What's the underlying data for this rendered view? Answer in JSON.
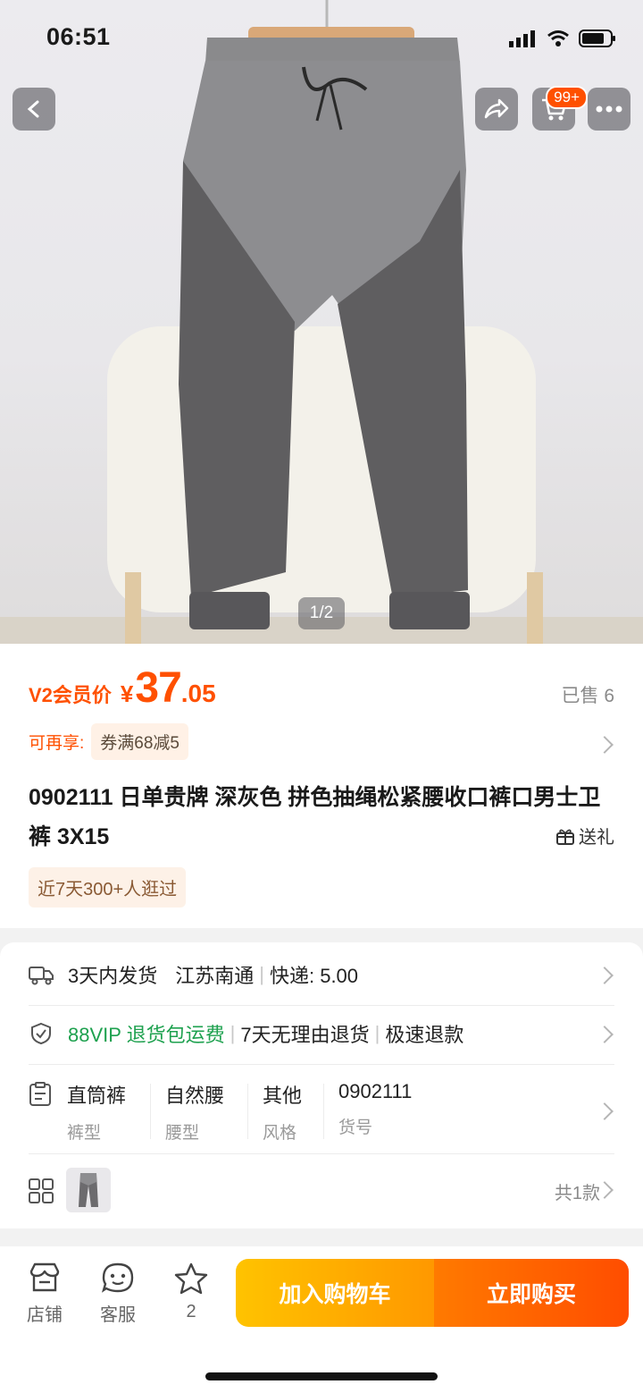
{
  "status_bar": {
    "time": "06:51"
  },
  "hero": {
    "pager": "1/2",
    "cart_badge": "99+",
    "image_alt": "grey jogger pants"
  },
  "price": {
    "label": "V2会员价",
    "currency": "¥",
    "integer": "37",
    "decimal": ".05",
    "sold": "已售 6"
  },
  "promo": {
    "label": "可再享:",
    "coupon": "券满68减5"
  },
  "product": {
    "title": "0902111 日单贵牌 深灰色 拼色抽绳松紧腰收口裤口男士卫裤 3X15",
    "gift": "送礼",
    "browse": "近7天300+人逛过"
  },
  "shipping": {
    "time": "3天内发货",
    "origin": "江苏南通",
    "fee": "快递: 5.00"
  },
  "service": {
    "vip": "88VIP 退货包运费",
    "return": "7天无理由退货",
    "refund": "极速退款"
  },
  "attributes": [
    {
      "value": "直筒裤",
      "key": "裤型"
    },
    {
      "value": "自然腰",
      "key": "腰型"
    },
    {
      "value": "其他",
      "key": "风格"
    },
    {
      "value": "0902111",
      "key": "货号"
    }
  ],
  "variants": {
    "count": "共1款"
  },
  "bottom_bar": {
    "shop": "店铺",
    "service": "客服",
    "fav_count": "2",
    "add_cart": "加入购物车",
    "buy_now": "立即购买"
  },
  "colors": {
    "accent": "#ff5000",
    "green": "#1ea14f",
    "cart_btn": "#ffa800",
    "buy_btn": "#ff5a00"
  }
}
